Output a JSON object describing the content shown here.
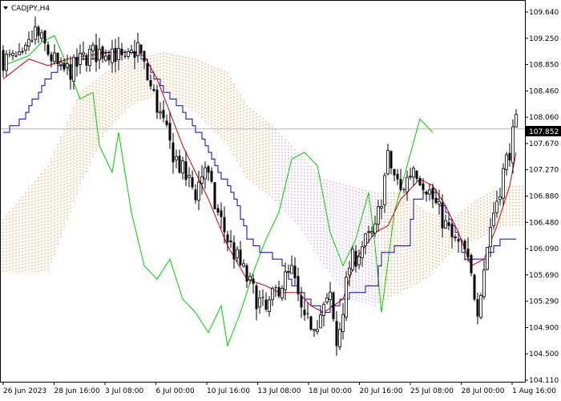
{
  "window": {
    "symbol_label": "CADJPY,H4",
    "current_price": "107.852"
  },
  "colors": {
    "background": "#ffffff",
    "candle": "#000000",
    "tenkan": "#d00000",
    "kijun": "#0000c0",
    "chikou": "#00d000",
    "kumo_bull": "#f2a060",
    "kumo_bear": "#c8a0d8",
    "price_line": "#b8b8b8",
    "price_tag_bg": "#000000"
  },
  "chart_data": {
    "type": "candlestick",
    "title": "CADJPY,H4",
    "indicators": [
      "Ichimoku Kinko Hyo"
    ],
    "y_ticks": [
      "109.640",
      "109.250",
      "108.850",
      "108.460",
      "108.060",
      "107.670",
      "107.270",
      "106.880",
      "106.480",
      "106.090",
      "105.690",
      "105.290",
      "104.900",
      "104.500",
      "104.110"
    ],
    "ylim": [
      104.11,
      109.64
    ],
    "x_ticks": [
      "26 Jun 2023",
      "28 Jun 16:00",
      "3 Jul 08:00",
      "6 Jul 00:00",
      "10 Jul 16:00",
      "13 Jul 08:00",
      "18 Jul 00:00",
      "20 Jul 16:00",
      "25 Jul 08:00",
      "28 Jul 00:00",
      "1 Aug 16:00"
    ],
    "current_price": 107.852,
    "anchors": {
      "close": [
        [
          0,
          108.9
        ],
        [
          6,
          108.85
        ],
        [
          10,
          109.3
        ],
        [
          14,
          109.0
        ],
        [
          18,
          108.7
        ],
        [
          22,
          108.75
        ],
        [
          26,
          108.95
        ],
        [
          30,
          109.0
        ],
        [
          34,
          109.05
        ],
        [
          38,
          108.8
        ],
        [
          42,
          109.1
        ],
        [
          45,
          108.6
        ],
        [
          48,
          108.2
        ],
        [
          52,
          107.6
        ],
        [
          56,
          107.2
        ],
        [
          60,
          106.9
        ],
        [
          63,
          107.3
        ],
        [
          66,
          106.7
        ],
        [
          70,
          106.2
        ],
        [
          74,
          105.8
        ],
        [
          78,
          105.4
        ],
        [
          82,
          105.1
        ],
        [
          86,
          105.5
        ],
        [
          90,
          105.7
        ],
        [
          94,
          104.9
        ],
        [
          98,
          105.0
        ],
        [
          102,
          105.3
        ],
        [
          104,
          104.6
        ],
        [
          108,
          105.8
        ],
        [
          112,
          106.1
        ],
        [
          116,
          106.3
        ],
        [
          120,
          107.4
        ],
        [
          124,
          106.9
        ],
        [
          128,
          107.3
        ],
        [
          132,
          107.0
        ],
        [
          136,
          106.6
        ],
        [
          140,
          106.2
        ],
        [
          144,
          106.0
        ],
        [
          148,
          105.2
        ],
        [
          152,
          106.4
        ],
        [
          156,
          107.2
        ],
        [
          160,
          107.9
        ]
      ],
      "tenkan": [
        [
          0,
          108.6
        ],
        [
          8,
          108.9
        ],
        [
          14,
          108.8
        ],
        [
          20,
          108.9
        ],
        [
          26,
          108.95
        ],
        [
          34,
          109.0
        ],
        [
          40,
          109.0
        ],
        [
          44,
          108.95
        ],
        [
          48,
          108.6
        ],
        [
          52,
          108.1
        ],
        [
          56,
          107.6
        ],
        [
          60,
          107.2
        ],
        [
          64,
          106.8
        ],
        [
          70,
          106.1
        ],
        [
          76,
          105.6
        ],
        [
          82,
          105.5
        ],
        [
          86,
          105.4
        ],
        [
          92,
          105.4
        ],
        [
          96,
          105.2
        ],
        [
          100,
          105.1
        ],
        [
          106,
          105.3
        ],
        [
          110,
          105.9
        ],
        [
          116,
          106.3
        ],
        [
          120,
          106.4
        ],
        [
          124,
          106.8
        ],
        [
          130,
          107.1
        ],
        [
          134,
          107.0
        ],
        [
          138,
          106.7
        ],
        [
          142,
          106.3
        ],
        [
          146,
          105.8
        ],
        [
          150,
          105.9
        ],
        [
          154,
          106.4
        ],
        [
          158,
          107.0
        ],
        [
          160,
          107.5
        ]
      ],
      "kijun": [
        [
          0,
          107.8
        ],
        [
          6,
          108.0
        ],
        [
          12,
          108.5
        ],
        [
          18,
          108.8
        ],
        [
          26,
          108.9
        ],
        [
          34,
          109.0
        ],
        [
          42,
          109.0
        ],
        [
          46,
          108.7
        ],
        [
          50,
          108.4
        ],
        [
          56,
          108.1
        ],
        [
          62,
          107.7
        ],
        [
          66,
          107.3
        ],
        [
          72,
          106.8
        ],
        [
          76,
          106.2
        ],
        [
          80,
          106.0
        ],
        [
          86,
          105.9
        ],
        [
          90,
          105.5
        ],
        [
          96,
          105.2
        ],
        [
          100,
          105.1
        ],
        [
          106,
          105.3
        ],
        [
          110,
          105.4
        ],
        [
          116,
          105.5
        ],
        [
          118,
          106.0
        ],
        [
          126,
          106.1
        ],
        [
          128,
          106.8
        ],
        [
          134,
          106.9
        ],
        [
          140,
          106.4
        ],
        [
          144,
          105.9
        ],
        [
          150,
          105.9
        ],
        [
          154,
          106.1
        ],
        [
          156,
          106.2
        ],
        [
          160,
          106.2
        ]
      ],
      "chikou": [
        [
          0,
          108.8
        ],
        [
          8,
          108.95
        ],
        [
          12,
          109.15
        ],
        [
          16,
          109.25
        ],
        [
          20,
          108.8
        ],
        [
          24,
          108.3
        ],
        [
          28,
          108.4
        ],
        [
          30,
          107.6
        ],
        [
          34,
          107.2
        ],
        [
          36,
          107.8
        ],
        [
          40,
          106.6
        ],
        [
          44,
          105.8
        ],
        [
          48,
          105.6
        ],
        [
          52,
          105.9
        ],
        [
          56,
          105.3
        ],
        [
          60,
          105.1
        ],
        [
          64,
          104.8
        ],
        [
          68,
          105.2
        ],
        [
          70,
          104.6
        ],
        [
          74,
          105.1
        ],
        [
          78,
          105.7
        ],
        [
          82,
          106.2
        ],
        [
          86,
          106.6
        ],
        [
          90,
          107.4
        ],
        [
          94,
          107.5
        ],
        [
          98,
          107.3
        ],
        [
          102,
          106.3
        ],
        [
          106,
          105.8
        ],
        [
          110,
          106.2
        ],
        [
          114,
          106.9
        ],
        [
          116,
          106.1
        ],
        [
          118,
          105.1
        ],
        [
          122,
          106.6
        ],
        [
          126,
          107.3
        ],
        [
          130,
          108.0
        ],
        [
          134,
          107.8
        ]
      ],
      "cloud_top": [
        [
          0,
          106.5
        ],
        [
          14,
          107.3
        ],
        [
          24,
          108.4
        ],
        [
          32,
          108.7
        ],
        [
          40,
          108.9
        ],
        [
          50,
          109.0
        ],
        [
          60,
          108.9
        ],
        [
          70,
          108.7
        ],
        [
          76,
          108.2
        ],
        [
          84,
          107.9
        ],
        [
          92,
          107.5
        ],
        [
          100,
          107.1
        ],
        [
          108,
          107.0
        ],
        [
          116,
          106.9
        ],
        [
          124,
          106.9
        ],
        [
          132,
          106.6
        ],
        [
          140,
          106.5
        ],
        [
          148,
          106.8
        ],
        [
          156,
          107.0
        ],
        [
          162,
          107.0
        ]
      ],
      "cloud_bottom": [
        [
          0,
          105.7
        ],
        [
          14,
          105.7
        ],
        [
          24,
          107.0
        ],
        [
          32,
          107.8
        ],
        [
          40,
          108.2
        ],
        [
          50,
          108.4
        ],
        [
          60,
          108.1
        ],
        [
          70,
          107.6
        ],
        [
          76,
          107.1
        ],
        [
          84,
          106.8
        ],
        [
          92,
          106.4
        ],
        [
          100,
          105.8
        ],
        [
          108,
          105.3
        ],
        [
          116,
          105.2
        ],
        [
          124,
          105.4
        ],
        [
          132,
          105.6
        ],
        [
          140,
          106.0
        ],
        [
          148,
          106.2
        ],
        [
          156,
          106.4
        ],
        [
          162,
          106.4
        ]
      ]
    }
  }
}
